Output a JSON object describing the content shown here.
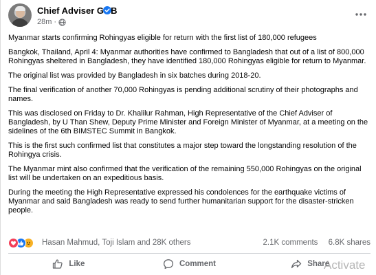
{
  "post": {
    "author": "Chief Adviser GOB",
    "time": "28m",
    "paragraphs": [
      "Myanmar starts confirming Rohingyas eligible for return with the first list of 180,000 refugees",
      "Bangkok, Thailand, April 4: Myanmar authorities have confirmed to Bangladesh that out of a list of 800,000 Rohingyas sheltered in Bangladesh, they have identified 180,000 Rohingyas eligible for return to Myanmar.",
      "The original list was provided by Bangladesh in six batches during 2018-20.",
      "The final verification of another 70,000 Rohingyas is pending additional scrutiny of their photographs and names.",
      "This was disclosed on Friday to Dr. Khalilur Rahman, High Representative of the Chief Adviser of Bangladesh, by U Than Shew, Deputy Prime Minister and Foreign Minister of Myanmar, at a meeting on the sidelines of the 6th BIMSTEC Summit in Bangkok.",
      "This is the first such confirmed list that constitutes a major step toward the longstanding resolution of the Rohingya crisis.",
      "The Myanmar mint also confirmed that the verification of the remaining 550,000 Rohingyas on the original list will be undertaken on an expeditious basis.",
      "During the meeting the High Representative expressed his condolences for the earthquake victims of Myanmar and said Bangladesh was ready to send further humanitarian support for the disaster-stricken people."
    ]
  },
  "reactions": {
    "summary": "Hasan Mahmud, Toji Islam and 28K others",
    "comments": "2.1K comments",
    "shares": "6.8K shares",
    "types": [
      "love-icon",
      "like-icon",
      "care-icon"
    ]
  },
  "actions": {
    "like": "Like",
    "comment": "Comment",
    "share": "Share"
  },
  "watermark": "Activate",
  "colors": {
    "verified": "#1877f2",
    "secondary_text": "#65676b",
    "love": "#f33e58",
    "like": "#1877f2",
    "care": "#f7b125"
  }
}
